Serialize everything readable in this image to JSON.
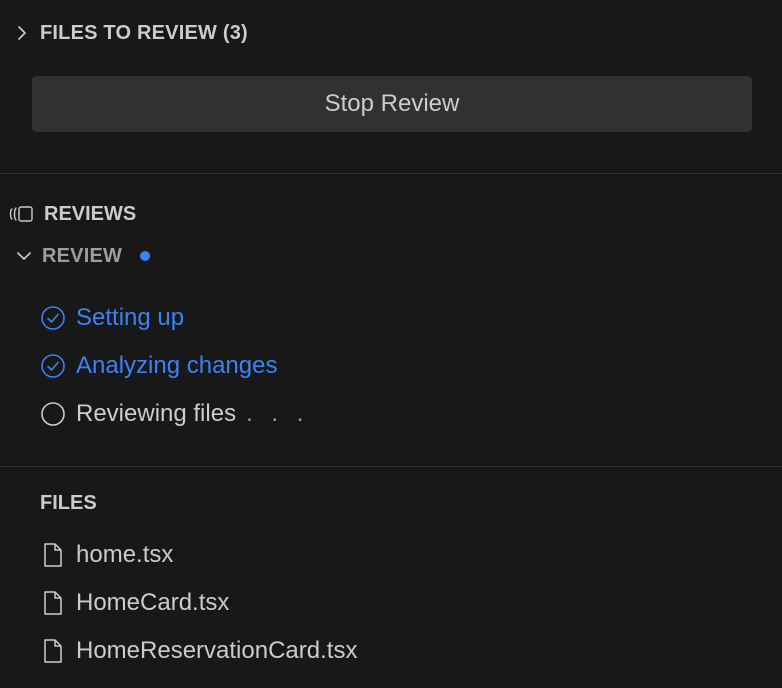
{
  "files_to_review": {
    "title": "FILES TO REVIEW (3)",
    "stop_button_label": "Stop Review"
  },
  "reviews_panel": {
    "title": "REVIEWS",
    "review": {
      "title": "REVIEW",
      "status_dot_color": "#3b82f6",
      "steps": [
        {
          "label": "Setting up",
          "status": "done",
          "icon": "check-circle-icon"
        },
        {
          "label": "Analyzing changes",
          "status": "done",
          "icon": "check-circle-icon"
        },
        {
          "label": "Reviewing files",
          "status": "pending",
          "icon": "circle-icon",
          "suffix": ". . ."
        }
      ]
    }
  },
  "files": {
    "title": "FILES",
    "items": [
      {
        "name": "home.tsx",
        "icon": "file-icon"
      },
      {
        "name": "HomeCard.tsx",
        "icon": "file-icon"
      },
      {
        "name": "HomeReservationCard.tsx",
        "icon": "file-icon"
      }
    ]
  },
  "colors": {
    "background": "#181818",
    "text": "#cccccc",
    "muted": "#9d9d9d",
    "accent": "#3b82f6",
    "button_bg": "#313131"
  }
}
